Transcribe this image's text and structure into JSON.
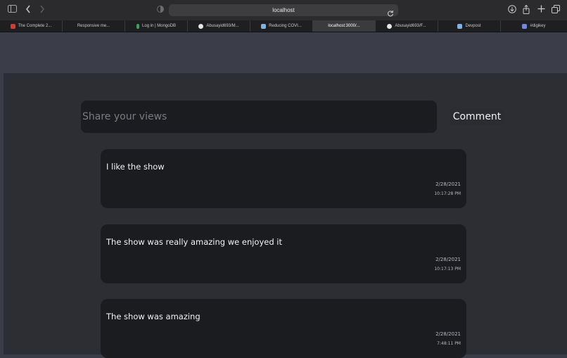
{
  "browser": {
    "url": "localhost",
    "tabs": [
      {
        "label": "The Complete 2...",
        "favicon_color": "#d83b2f",
        "active": false
      },
      {
        "label": "Responsive me...",
        "favicon_color": "",
        "active": false
      },
      {
        "label": "Log in | MongoDB",
        "favicon_color": "#3fa34d",
        "active": false
      },
      {
        "label": "Abusayid693/M...",
        "favicon_color": "#e6e6e6",
        "active": false
      },
      {
        "label": "Reducing COVI...",
        "favicon_color": "#7fb3e3",
        "active": false
      },
      {
        "label": "localhost:3000/...",
        "favicon_color": "",
        "active": true
      },
      {
        "label": "Abusayid693/F...",
        "favicon_color": "#e6e6e6",
        "active": false
      },
      {
        "label": "Devpost",
        "favicon_color": "#7fb3e3",
        "active": false
      },
      {
        "label": "#digikey",
        "favicon_color": "#7289da",
        "active": false
      }
    ]
  },
  "composer": {
    "placeholder": "Share your views",
    "button_label": "Comment"
  },
  "comments": [
    {
      "text": "I like the show",
      "date": "2/28/2021",
      "time": "10:17:28 PM"
    },
    {
      "text": "The show was really amazing we enjoyed it",
      "date": "2/28/2021",
      "time": "10:17:13 PM"
    },
    {
      "text": "The show was amazing",
      "date": "2/28/2021",
      "time": "7:48:11 PM"
    }
  ]
}
